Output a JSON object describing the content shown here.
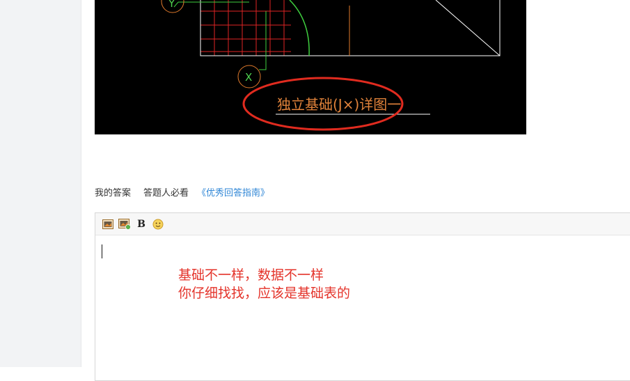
{
  "cad": {
    "axis_top": "Y",
    "axis_bottom": "X",
    "detail_title": "独立基础(J×)详图一",
    "colors": {
      "grid": "#e02424",
      "green": "#3fcf3f",
      "orange": "#e07a2c",
      "white": "#ffffff",
      "highlight": "#e02b1f"
    }
  },
  "answer_bar": {
    "my_answer": "我的答案",
    "must_read": "答题人必看",
    "guide_link": "《优秀回答指南》"
  },
  "toolbar": {
    "image_icon": "image-icon",
    "image_insert_icon": "image-upload-icon",
    "bold_label": "B",
    "emoji_icon": "emoji-icon"
  },
  "editor": {
    "line1": "基础不一样，数据不一样",
    "line2": "你仔细找找，应该是基础表的"
  },
  "colors": {
    "link": "#2f86d6",
    "answer_text": "#e4332a"
  }
}
